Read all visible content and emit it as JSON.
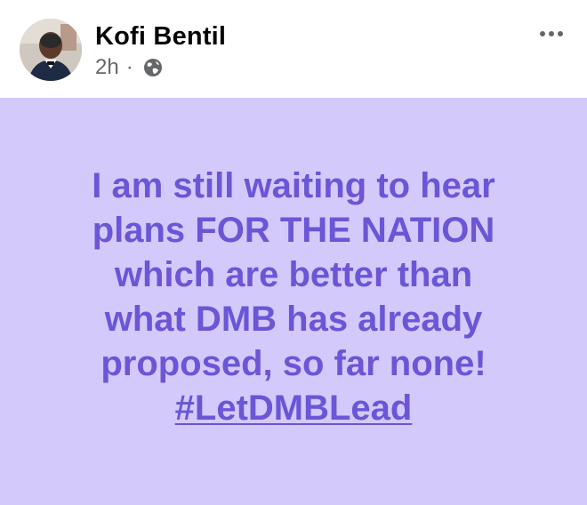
{
  "post": {
    "author": "Kofi Bentil",
    "time": "2h",
    "separator": "·",
    "audience_icon": "globe-icon",
    "more_icon": "more-options-icon"
  },
  "content": {
    "background_color": "#d4c9fb",
    "text_color": "#6a56d6",
    "lines": [
      "I am still waiting to hear",
      "plans FOR THE NATION",
      "which are better than",
      "what DMB has already",
      "proposed, so far none!"
    ],
    "hashtag": "#LetDMBLead"
  }
}
